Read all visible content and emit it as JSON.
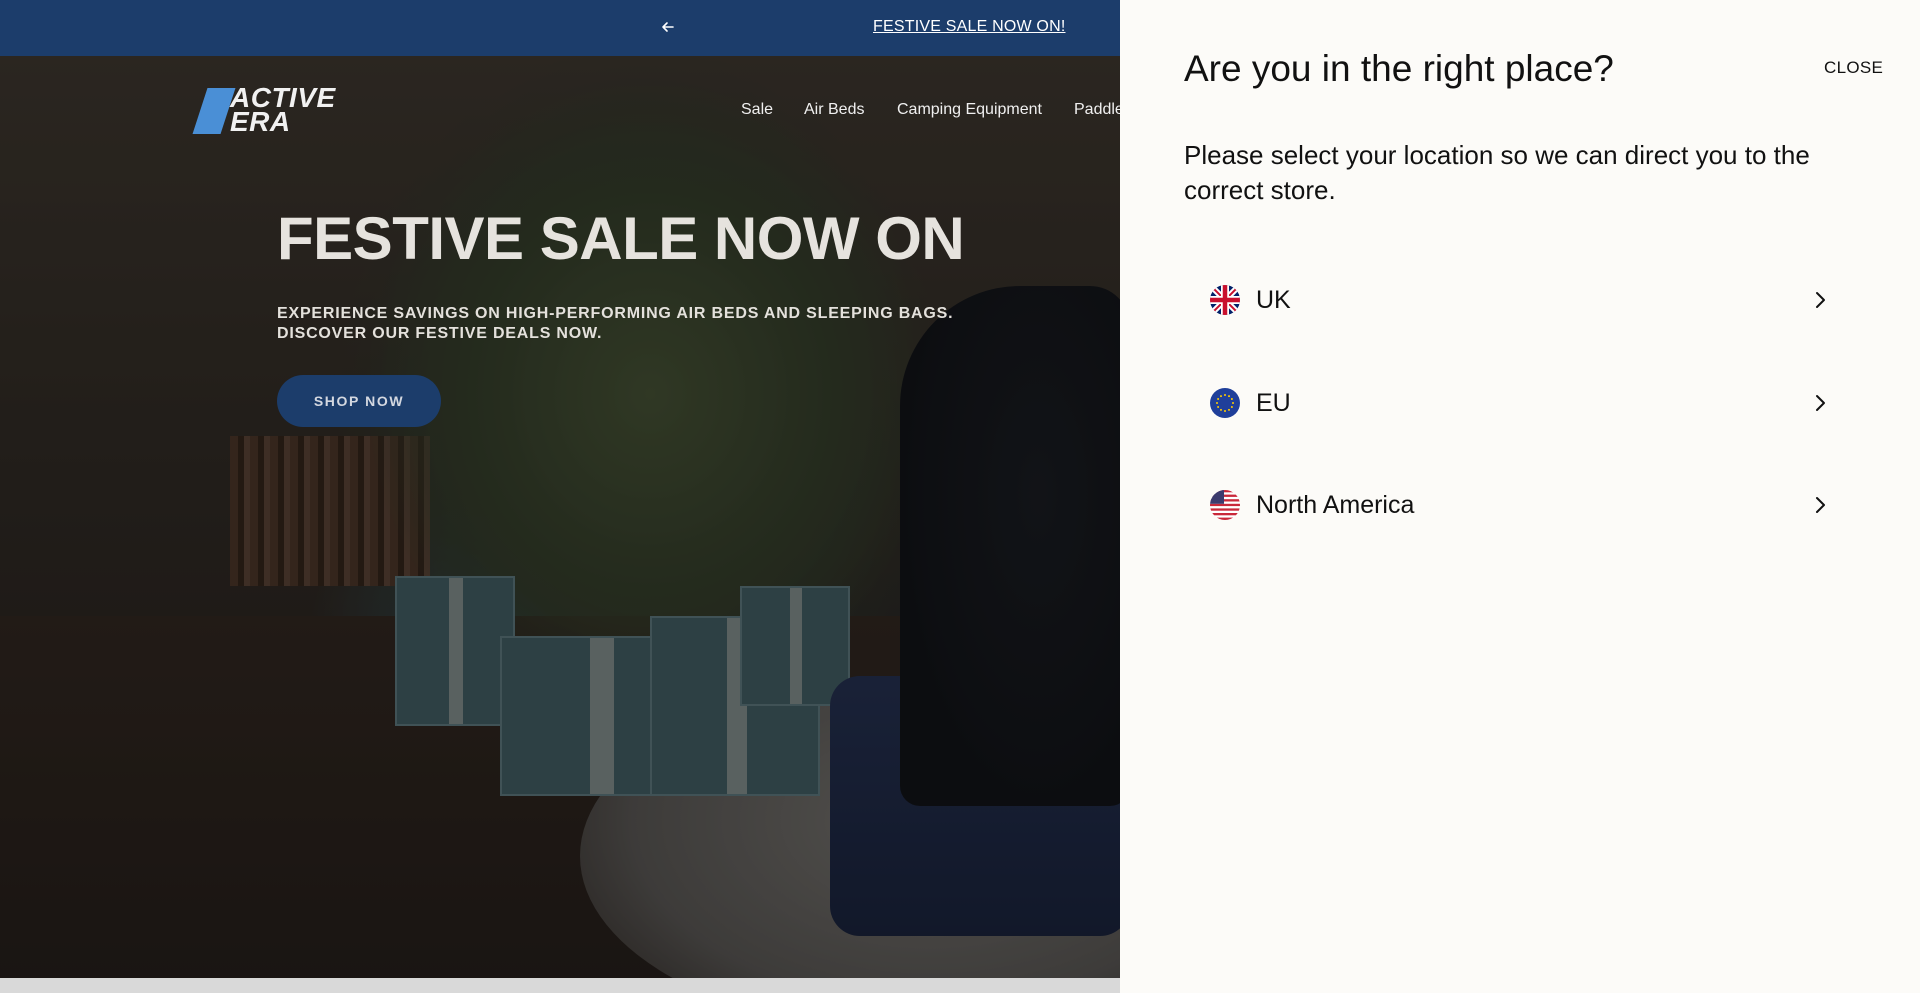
{
  "announcement": {
    "prev_icon": "arrow-left-icon",
    "message": "FESTIVE SALE NOW ON!"
  },
  "header": {
    "logo_line1": "ACTIVE",
    "logo_line2": "ERA",
    "nav_items": [
      "Sale",
      "Air Beds",
      "Camping Equipment",
      "Paddle"
    ]
  },
  "hero": {
    "title": "FESTIVE SALE NOW ON",
    "subtitle": "EXPERIENCE SAVINGS ON HIGH-PERFORMING AIR BEDS AND SLEEPING BAGS. DISCOVER OUR FESTIVE DEALS NOW.",
    "cta_label": "SHOP NOW"
  },
  "location_drawer": {
    "title": "Are you in the right place?",
    "close_label": "CLOSE",
    "description": "Please select your location so we can direct you to the correct store.",
    "locations": [
      {
        "label": "UK",
        "icon": "uk-flag-icon"
      },
      {
        "label": "EU",
        "icon": "eu-flag-icon"
      },
      {
        "label": "North America",
        "icon": "us-flag-icon"
      }
    ]
  },
  "colors": {
    "brand_navy": "#1c3d6b",
    "logo_accent": "#4a8fd6",
    "drawer_bg": "#fcfbf8"
  }
}
